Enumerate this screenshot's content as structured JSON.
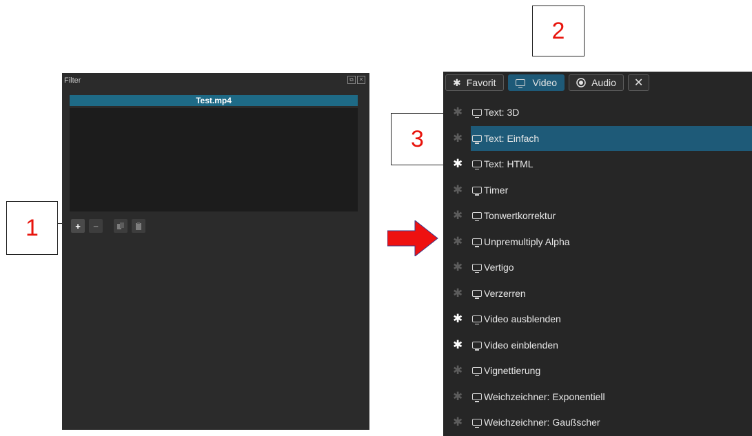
{
  "filter_panel": {
    "title": "Filter",
    "clip_name": "Test.mp4",
    "toolbar": {
      "add": "+",
      "remove": "−",
      "copy": "copy-icon",
      "paste": "paste-icon"
    }
  },
  "catalog": {
    "tabs": [
      {
        "label": "Favorit",
        "icon": "star-icon"
      },
      {
        "label": "Video",
        "icon": "monitor-icon",
        "selected": true
      },
      {
        "label": "Audio",
        "icon": "audio-icon"
      }
    ],
    "close_label": "✕",
    "items": [
      {
        "label": "Text: 3D",
        "favorite": false
      },
      {
        "label": "Text: Einfach",
        "favorite": false,
        "selected": true
      },
      {
        "label": "Text: HTML",
        "favorite": true
      },
      {
        "label": "Timer",
        "favorite": false
      },
      {
        "label": "Tonwertkorrektur",
        "favorite": false
      },
      {
        "label": "Unpremultiply Alpha",
        "favorite": false
      },
      {
        "label": "Vertigo",
        "favorite": false
      },
      {
        "label": "Verzerren",
        "favorite": false
      },
      {
        "label": "Video ausblenden",
        "favorite": true
      },
      {
        "label": "Video einblenden",
        "favorite": true
      },
      {
        "label": "Vignettierung",
        "favorite": false
      },
      {
        "label": "Weichzeichner: Exponentiell",
        "favorite": false
      },
      {
        "label": "Weichzeichner: Gaußscher",
        "favorite": false
      }
    ]
  },
  "annotations": {
    "one": "1",
    "two": "2",
    "three": "3"
  },
  "colors": {
    "accent": "#1e5a78",
    "annotation": "#e8140c",
    "arrow": "#ee1111"
  }
}
